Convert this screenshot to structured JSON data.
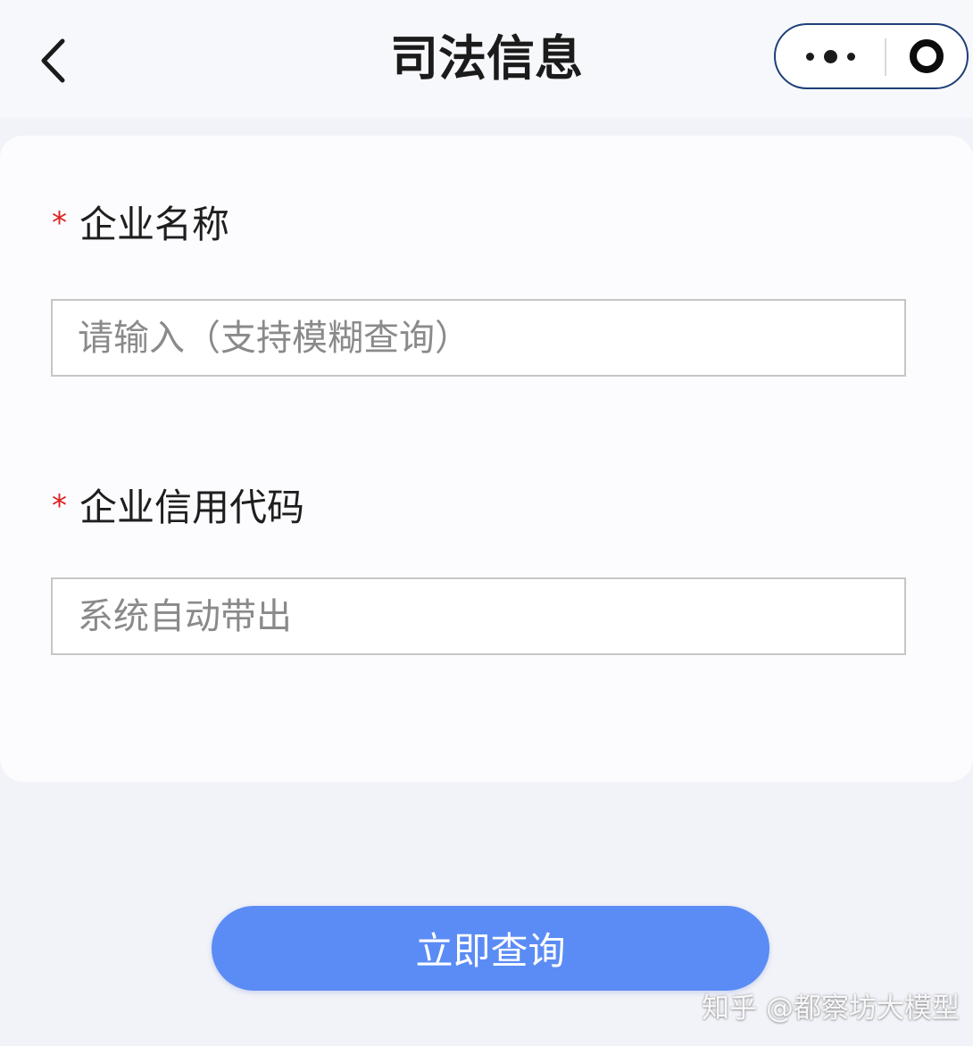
{
  "nav": {
    "title": "司法信息",
    "back_icon": "chevron-left-icon",
    "more_icon": "more-dots-icon",
    "close_icon": "target-circle-icon",
    "capsule_border_color": "#1e3f78"
  },
  "form": {
    "required_mark": "*",
    "company_name": {
      "label": "企业名称",
      "placeholder": "请输入（支持模糊查询）",
      "value": ""
    },
    "credit_code": {
      "label": "企业信用代码",
      "placeholder": "系统自动带出",
      "value": ""
    }
  },
  "actions": {
    "submit_label": "立即查询",
    "submit_color": "#5b8cf5"
  },
  "watermark": {
    "text": "知乎 @都察坊大模型"
  }
}
